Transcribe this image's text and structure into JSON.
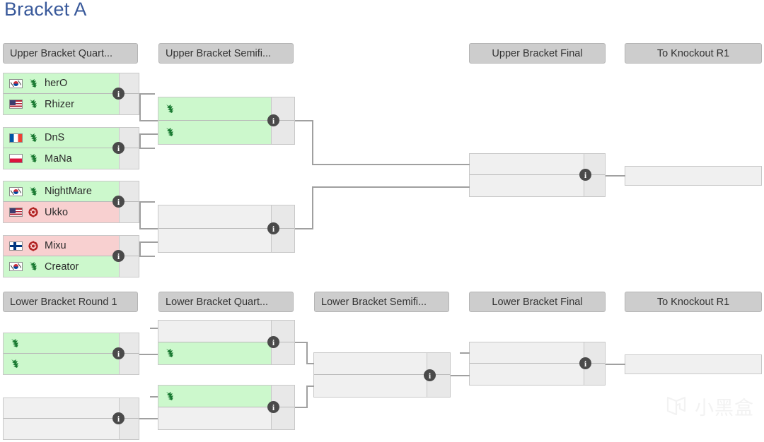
{
  "page": {
    "title": "Bracket A",
    "title_color": "#3a5a9b",
    "watermark_text": "小黑盒",
    "watermark_mark": "␢"
  },
  "colors": {
    "protoss_bg": "#ccf8cc",
    "zerg_bg": "#f8d0d0",
    "empty_bg": "#f0f0f0",
    "header_bg": "#cdcdcd",
    "connector": "#a0a0a0",
    "info_badge": "#4a4a4a"
  },
  "headers": {
    "ub_quarterfinals": "Upper Bracket Quart...",
    "ub_semifinals": "Upper Bracket Semifi...",
    "ub_final": "Upper Bracket Final",
    "ub_knockout": "To Knockout R1",
    "lb_round1": "Lower Bracket Round 1",
    "lb_quarterfinals": "Lower Bracket Quart...",
    "lb_semifinals": "Lower Bracket Semifi...",
    "lb_final": "Lower Bracket Final",
    "lb_knockout": "To Knockout R1"
  },
  "info_label": "i",
  "upper_bracket": {
    "quarterfinals": [
      {
        "id": "ubqf1",
        "top": {
          "name": "herO",
          "flag": "kr",
          "race": "protoss",
          "score": ""
        },
        "bottom": {
          "name": "Rhizer",
          "flag": "us",
          "race": "protoss",
          "score": ""
        }
      },
      {
        "id": "ubqf2",
        "top": {
          "name": "DnS",
          "flag": "fr",
          "race": "protoss",
          "score": ""
        },
        "bottom": {
          "name": "MaNa",
          "flag": "pl",
          "race": "protoss",
          "score": ""
        }
      },
      {
        "id": "ubqf3",
        "top": {
          "name": "NightMare",
          "flag": "kr",
          "race": "protoss",
          "score": ""
        },
        "bottom": {
          "name": "Ukko",
          "flag": "us",
          "race": "zerg",
          "score": ""
        }
      },
      {
        "id": "ubqf4",
        "top": {
          "name": "Mixu",
          "flag": "fi",
          "race": "zerg",
          "score": ""
        },
        "bottom": {
          "name": "Creator",
          "flag": "kr",
          "race": "protoss",
          "score": ""
        }
      }
    ],
    "semifinals": [
      {
        "id": "ubsf1",
        "top": {
          "name": "",
          "flag": "",
          "race": "protoss",
          "score": ""
        },
        "bottom": {
          "name": "",
          "flag": "",
          "race": "protoss",
          "score": ""
        }
      },
      {
        "id": "ubsf2",
        "top": {
          "name": "",
          "flag": "",
          "race": "empty",
          "score": ""
        },
        "bottom": {
          "name": "",
          "flag": "",
          "race": "empty",
          "score": ""
        }
      }
    ],
    "final": [
      {
        "id": "ubf1",
        "top": {
          "name": "",
          "flag": "",
          "race": "empty",
          "score": ""
        },
        "bottom": {
          "name": "",
          "flag": "",
          "race": "empty",
          "score": ""
        }
      }
    ],
    "knockout": [
      {
        "id": "ubko1",
        "name": "",
        "flag": "",
        "race": "empty"
      }
    ]
  },
  "lower_bracket": {
    "round1": [
      {
        "id": "lbr1m1",
        "top": {
          "name": "",
          "flag": "",
          "race": "protoss",
          "score": ""
        },
        "bottom": {
          "name": "",
          "flag": "",
          "race": "protoss",
          "score": ""
        }
      },
      {
        "id": "lbr1m2",
        "top": {
          "name": "",
          "flag": "",
          "race": "empty",
          "score": ""
        },
        "bottom": {
          "name": "",
          "flag": "",
          "race": "empty",
          "score": ""
        }
      }
    ],
    "quarterfinals": [
      {
        "id": "lbqf1",
        "top": {
          "name": "",
          "flag": "",
          "race": "empty",
          "score": ""
        },
        "bottom": {
          "name": "",
          "flag": "",
          "race": "protoss",
          "score": ""
        }
      },
      {
        "id": "lbqf2",
        "top": {
          "name": "",
          "flag": "",
          "race": "protoss",
          "score": ""
        },
        "bottom": {
          "name": "",
          "flag": "",
          "race": "empty",
          "score": ""
        }
      }
    ],
    "semifinals": [
      {
        "id": "lbsf1",
        "top": {
          "name": "",
          "flag": "",
          "race": "empty",
          "score": ""
        },
        "bottom": {
          "name": "",
          "flag": "",
          "race": "empty",
          "score": ""
        }
      }
    ],
    "final": [
      {
        "id": "lbf1",
        "top": {
          "name": "",
          "flag": "",
          "race": "empty",
          "score": ""
        },
        "bottom": {
          "name": "",
          "flag": "",
          "race": "empty",
          "score": ""
        }
      }
    ],
    "knockout": [
      {
        "id": "lbko1",
        "name": "",
        "flag": "",
        "race": "empty"
      }
    ]
  }
}
